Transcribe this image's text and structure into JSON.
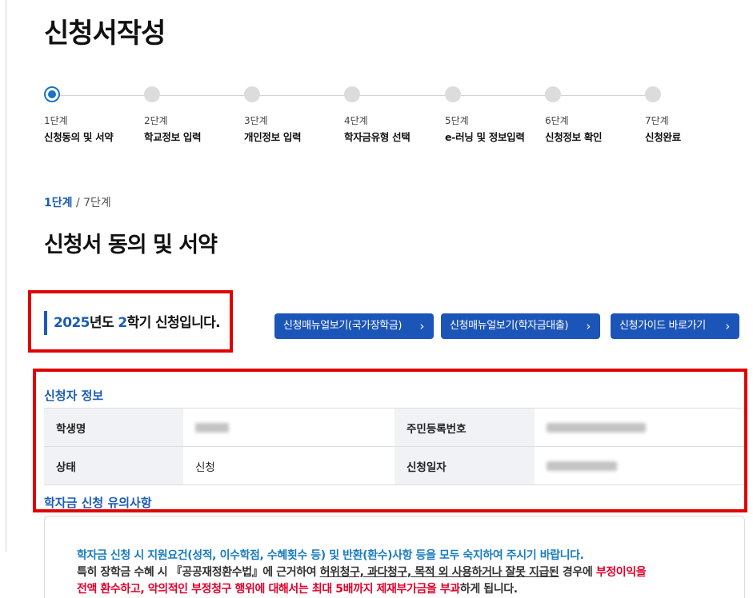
{
  "page": {
    "title": "신청서작성",
    "stage_current": "1단계",
    "stage_total": "/ 7단계",
    "section_title": "신청서 동의 및 서약"
  },
  "stepper": {
    "steps": [
      {
        "num": "1단계",
        "label": "신청동의 및 서약"
      },
      {
        "num": "2단계",
        "label": "학교정보 입력"
      },
      {
        "num": "3단계",
        "label": "개인정보 입력"
      },
      {
        "num": "4단계",
        "label": "학자금유형 선택"
      },
      {
        "num": "5단계",
        "label": "e-러닝 및 정보입력"
      },
      {
        "num": "6단계",
        "label": "신청정보 확인"
      },
      {
        "num": "7단계",
        "label": "신청완료"
      }
    ]
  },
  "semester": {
    "year": "2025",
    "year_suffix": "년도 ",
    "term": "2",
    "term_suffix": "학기 신청입니다."
  },
  "buttons": {
    "manual_national": "신청매뉴얼보기(국가장학금)",
    "manual_loan": "신청매뉴얼보기(학자금대출)",
    "guide": "신청가이드 바로가기",
    "chevron": "›"
  },
  "applicant": {
    "title": "신청자 정보",
    "student_name_label": "학생명",
    "resident_no_label": "주민등록번호",
    "status_label": "상태",
    "status_value": "신청",
    "apply_date_label": "신청일자"
  },
  "notice": {
    "title": "학자금 신청 유의사항",
    "line1": "학자금 신청 시 지원요건(성적, 이수학점, 수혜횟수 등) 및 반환(환수)사항 등을 모두 숙지하여 주시기 바랍니다.",
    "line2_a": "특히 장학금 수혜 시 『공공재정환수법』에 근거하여 ",
    "line2_b": "허위청구, 과다청구, 목적 외 사용하거나 잘못 지급된",
    "line2_c": " 경우에 ",
    "line2_d": "부정이익을",
    "line3_a": "전액 환수하고, 악의적인 부정청구 행위에 대해서는 최대 5배까지 제재부가금을 부과",
    "line3_b": "하게 됩니다."
  },
  "colors": {
    "accent_blue": "#1a5cb4",
    "button_blue": "#1c55b8",
    "highlight_red": "#e00000",
    "notice_cyan": "#1a7bbf",
    "warning_red": "#e0002a"
  }
}
